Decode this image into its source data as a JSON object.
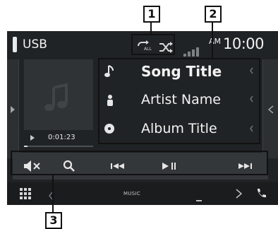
{
  "header": {
    "source_label": "USB",
    "clock_ampm": "AM",
    "clock_time": "10:00"
  },
  "status_icons": [
    "repeat-all-icon",
    "shuffle-icon",
    "signal-icon"
  ],
  "track": {
    "title": "Song Title",
    "artist": "Artist Name",
    "album": "Album Title",
    "elapsed": "0:01:23",
    "progress_fraction": 0.05
  },
  "controls": [
    {
      "name": "mute-button",
      "icon": "mute-icon"
    },
    {
      "name": "search-button",
      "icon": "search-icon"
    },
    {
      "name": "previous-button",
      "icon": "previous-icon"
    },
    {
      "name": "play-pause-button",
      "icon": "play-pause-icon"
    },
    {
      "name": "next-button",
      "icon": "next-icon"
    }
  ],
  "bottom_bar": {
    "label": "MUSIC"
  },
  "callouts": [
    {
      "number": "1"
    },
    {
      "number": "2"
    },
    {
      "number": "3"
    }
  ],
  "colors": {
    "screen_bg": "#202325",
    "panel_bg": "#33373a",
    "text": "#f2f2f2",
    "muted_text": "#bfc3c6",
    "callout": "#111111"
  }
}
